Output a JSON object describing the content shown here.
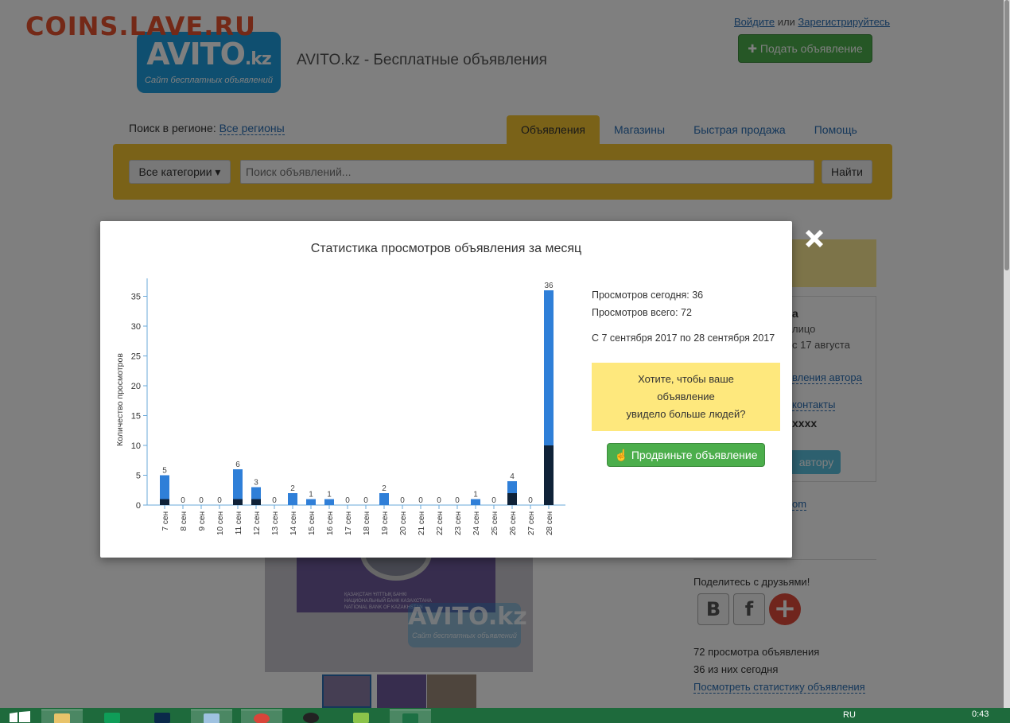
{
  "header": {
    "watermark": "COINS.LAVE.RU",
    "logo_big": "AVITO",
    "logo_suffix": ".kz",
    "logo_tagline": "Сайт бесплатных объявлений",
    "site_title": "AVITO.kz - Бесплатные объявления",
    "login": "Войдите",
    "or": "или",
    "register": "Зарегистрируйтесь",
    "post_ad": "Подать объявление"
  },
  "nav": {
    "region_label": "Поиск в регионе:",
    "region_value": "Все регионы",
    "tabs": [
      "Объявления",
      "Магазины",
      "Быстрая продажа",
      "Помощь"
    ]
  },
  "search": {
    "category": "Все категории",
    "placeholder": "Поиск объявлений...",
    "button": "Найти"
  },
  "sidebar_fragments": {
    "f1": "а",
    "f2": "лицо",
    "f3": "с 17 августа",
    "f4": "вления автора",
    "f5": "контакты",
    "f6": "xxxx",
    "f7": "автору",
    "f8": "om"
  },
  "photo": {
    "bank_line1": "ҚАЗАҚСТАН ҰЛТТЫҚ БАНКІ",
    "bank_line2": "НАЦИОНАЛЬНЫЙ БАНК КАЗАХСТАНА",
    "bank_line3": "NATIONAL BANK OF KAZAKHSTAN",
    "wm_big": "AVITO.kz",
    "wm_small": "Сайт бесплатных объявлений"
  },
  "share": {
    "title": "Поделитесь с друзьями!",
    "vk": "B",
    "fb": "f",
    "more": "+"
  },
  "stats_summary": {
    "total": "72 просмотра объявления",
    "today": "36 из них сегодня",
    "link": "Посмотреть статистику объявления"
  },
  "modal": {
    "title": "Статистика просмотров объявления за месяц",
    "views_today": "Просмотров сегодня: 36",
    "views_total": "Просмотров всего: 72",
    "period": "С 7 сентября 2017 по 28 сентября 2017",
    "promo_line1": "Хотите, чтобы ваше",
    "promo_line2": "объявление",
    "promo_line3": "увидело больше людей?",
    "promo_button": "Продвиньте объявление"
  },
  "chart_data": {
    "type": "bar",
    "ylabel": "Количество просмотров",
    "ylim": [
      0,
      38
    ],
    "yticks": [
      0,
      5,
      10,
      15,
      20,
      25,
      30,
      35
    ],
    "categories": [
      "7 сен",
      "8 сен",
      "9 сен",
      "10 сен",
      "11 сен",
      "12 сен",
      "13 сен",
      "14 сен",
      "15 сен",
      "16 сен",
      "17 сен",
      "18 сен",
      "19 сен",
      "20 сен",
      "21 сен",
      "22 сен",
      "23 сен",
      "24 сен",
      "25 сен",
      "26 сен",
      "27 сен",
      "28 сен"
    ],
    "values": [
      5,
      0,
      0,
      0,
      6,
      3,
      0,
      2,
      1,
      1,
      0,
      0,
      2,
      0,
      0,
      0,
      0,
      1,
      0,
      4,
      0,
      36
    ],
    "dark_values": [
      1,
      0,
      0,
      0,
      1,
      1,
      0,
      0,
      0,
      0,
      0,
      0,
      0,
      0,
      0,
      0,
      0,
      0,
      0,
      2,
      0,
      10
    ],
    "colors": {
      "bar": "#2f7fd8",
      "dark": "#0f2238",
      "axis": "#6aa8d8"
    },
    "grid": false
  },
  "taskbar": {
    "lang": "RU",
    "time": "0:43"
  }
}
